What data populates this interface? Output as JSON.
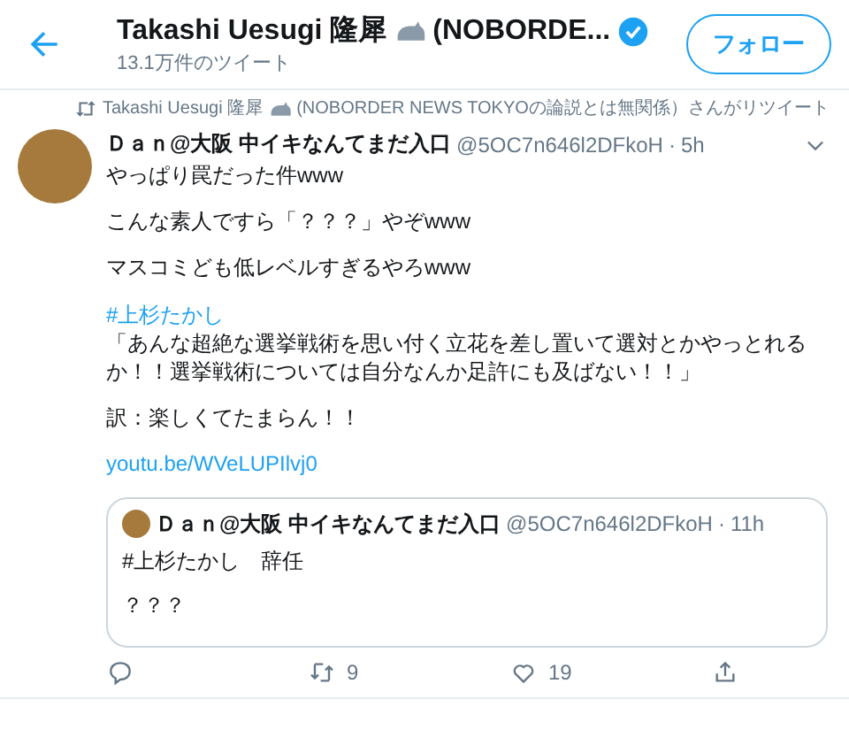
{
  "header": {
    "name_start": "Takashi Uesugi 隆犀",
    "name_end": "(NOBORDE...",
    "verified": true,
    "tweet_count": "13.1万件のツイート",
    "follow_button": "フォロー"
  },
  "retweet_banner": {
    "name": "Takashi Uesugi 隆犀",
    "text": "(NOBORDER NEWS TOKYOの論説とは無関係）さんがリツイート"
  },
  "tweet": {
    "display_name": "Ｄａｎ@大阪 中イキなんてまだ入口",
    "handle": "@5OC7n646l2DFkoH",
    "time": "5h",
    "paragraphs": [
      {
        "kind": "text",
        "text": "やっぱり罠だった件www"
      },
      {
        "kind": "text",
        "text": "こんな素人ですら「？？？」やぞwww"
      },
      {
        "kind": "text",
        "text": "マスコミども低レベルすぎるやろwww"
      },
      {
        "kind": "hashtag",
        "tag": "#上杉たかし",
        "text": "「あんな超絶な選挙戦術を思い付く立花を差し置いて選対とかやっとれるか！！選挙戦術については自分なんか足許にも及ばない！！」"
      },
      {
        "kind": "text",
        "text": "訳：楽しくてたまらん！！"
      },
      {
        "kind": "link",
        "text": "youtu.be/WVeLUPIlvj0"
      }
    ],
    "quote": {
      "display_name": "Ｄａｎ@大阪 中イキなんてまだ入口",
      "handle": "@5OC7n646l2DFkoH",
      "time": "11h",
      "lines": [
        "#上杉たかし　辞任",
        "？？？"
      ]
    },
    "separator": "·",
    "retweets": "9",
    "likes": "19"
  }
}
